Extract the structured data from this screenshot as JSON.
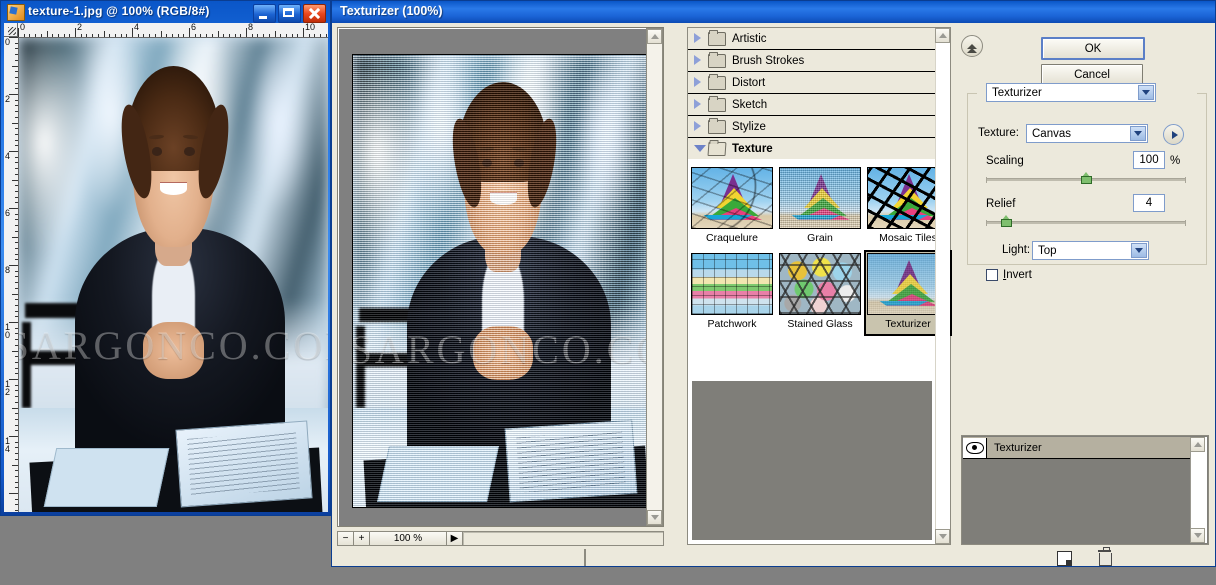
{
  "image_window": {
    "title": "texture-1.jpg @ 100% (RGB/8#)",
    "app_icon": "photoshop-document-icon",
    "window_buttons": [
      {
        "name": "minimize",
        "glyph": "_"
      },
      {
        "name": "maximize",
        "glyph": "□"
      },
      {
        "name": "close",
        "glyph": "✕"
      }
    ],
    "ruler_units_h": [
      "0",
      "2",
      "4",
      "6",
      "8",
      "10"
    ],
    "ruler_units_v": [
      "0",
      "2",
      "4",
      "6",
      "8",
      "10",
      "12",
      "14"
    ],
    "watermark": "SARGONCO.COM"
  },
  "dialog": {
    "title": "Texturizer (100%)",
    "buttons": {
      "ok": "OK",
      "cancel": "Cancel"
    },
    "collapse_icon": "double-chevron-up-icon"
  },
  "preview": {
    "zoom_out": "−",
    "zoom_in": "+",
    "zoom_value": "100 %",
    "play_glyph": "▶",
    "watermark": "SARGONCO.CO"
  },
  "filter_tree": {
    "categories": [
      {
        "label": "Artistic",
        "expanded": false
      },
      {
        "label": "Brush Strokes",
        "expanded": false
      },
      {
        "label": "Distort",
        "expanded": false
      },
      {
        "label": "Sketch",
        "expanded": false
      },
      {
        "label": "Stylize",
        "expanded": false
      },
      {
        "label": "Texture",
        "expanded": true
      }
    ],
    "thumbnails": [
      {
        "label": "Craquelure",
        "selected": false,
        "style": "craq"
      },
      {
        "label": "Grain",
        "selected": false,
        "style": "grainy"
      },
      {
        "label": "Mosaic Tiles",
        "selected": false,
        "style": "mosaic"
      },
      {
        "label": "Patchwork",
        "selected": false,
        "style": "patch"
      },
      {
        "label": "Stained Glass",
        "selected": false,
        "style": "stained"
      },
      {
        "label": "Texturizer",
        "selected": true,
        "style": "plain"
      }
    ]
  },
  "controls": {
    "filter_select": {
      "value": "Texturizer"
    },
    "texture_label": "Texture:",
    "texture_select": {
      "value": "Canvas"
    },
    "flyout_icon": "circle-right-arrow-icon",
    "scaling": {
      "label": "Scaling",
      "value": "100",
      "unit": "%",
      "slider_percent": 50
    },
    "relief": {
      "label": "Relief",
      "value": "4",
      "slider_percent": 8
    },
    "light": {
      "label": "Light:",
      "value": "Top"
    },
    "invert": {
      "label": "Invert",
      "checked": false
    }
  },
  "layers": {
    "items": [
      {
        "name": "Texturizer",
        "visible": true,
        "eye_icon": "eye-icon"
      }
    ],
    "new_effect_layer_icon": "new-effect-layer-icon",
    "delete_effect_layer_icon": "trash-icon"
  },
  "colors": {
    "titlebar_blue": "#1a63d6",
    "dialog_bg": "#ece9dc",
    "panel_gray": "#7f7e79",
    "selection_bg": "#c9c4ae",
    "slider_knob_green": "#7fbf6e",
    "desktop_gray": "#808080"
  }
}
